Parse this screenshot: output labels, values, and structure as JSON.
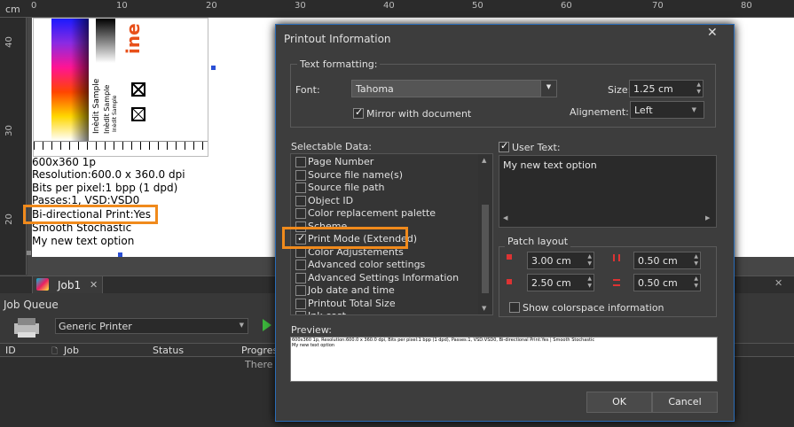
{
  "ruler": {
    "unit": "cm",
    "top_labels": [
      "0",
      "10",
      "20",
      "30",
      "40",
      "50",
      "60",
      "70",
      "80"
    ],
    "left_labels": [
      "40",
      "30",
      "20"
    ]
  },
  "document": {
    "print_strip": {
      "brand": "ine",
      "sample_labels": [
        "Inèdit Sample",
        "Inèdit Sample",
        "Inèdit Sample"
      ]
    },
    "info_lines": [
      "600x360 1p",
      "Resolution:600.0 x 360.0 dpi",
      "Bits per pixel:1 bpp (1 dpd)",
      "Passes:1, VSD:VSD0",
      "Bi-directional Print:Yes",
      "Smooth Stochastic",
      "My new text option"
    ]
  },
  "tabs": {
    "job_tab_label": "Job1",
    "close_glyph": "✕"
  },
  "job_queue": {
    "title": "Job Queue",
    "printer": "Generic Printer",
    "columns": [
      "ID",
      "Job",
      "Status",
      "Progres"
    ],
    "empty_text": "There a"
  },
  "dialog": {
    "title": "Printout Information",
    "text_formatting": {
      "group_label": "Text formatting:",
      "font_label": "Font:",
      "font_value": "Tahoma",
      "size_label": "Size:",
      "size_value": "1.25 cm",
      "mirror_label": "Mirror with document",
      "mirror_checked": true,
      "alignment_label": "Alignement:",
      "alignment_value": "Left"
    },
    "selectable_data": {
      "label": "Selectable Data:",
      "items": [
        {
          "label": "Page Number",
          "checked": false
        },
        {
          "label": "Source file name(s)",
          "checked": false
        },
        {
          "label": "Source file path",
          "checked": false
        },
        {
          "label": "Object ID",
          "checked": false
        },
        {
          "label": "Color replacement palette",
          "checked": false
        },
        {
          "label": "Scheme",
          "checked": false
        },
        {
          "label": "Print Mode (Extended)",
          "checked": true
        },
        {
          "label": "Color Adjustements",
          "checked": false
        },
        {
          "label": "Advanced color settings",
          "checked": false
        },
        {
          "label": "Advanced Settings Information",
          "checked": false
        },
        {
          "label": "Job date and time",
          "checked": false
        },
        {
          "label": "Printout Total Size",
          "checked": false
        },
        {
          "label": "Ink cost",
          "checked": false
        }
      ]
    },
    "user_text": {
      "label": "User Text:",
      "checked": true,
      "value": "My new text option"
    },
    "patch_layout": {
      "label": "Patch layout",
      "values": [
        "3.00 cm",
        "0.50 cm",
        "2.50 cm",
        "0.50 cm"
      ],
      "show_colorspace_label": "Show colorspace information",
      "show_colorspace_checked": false
    },
    "preview": {
      "label": "Preview:",
      "line1": "600x360 1p, Resolution:600.0 x 360.0 dpi, Bits per pixel:1 bpp (1 dpd), Passes:1, VSD:VSD0, Bi-directional Print:Yes | Smooth Stochastic",
      "line2": "My new text option"
    },
    "ok_label": "OK",
    "cancel_label": "Cancel"
  },
  "colors": {
    "highlight": "#f08a1c",
    "accent_blue": "#2a6cb8",
    "green_play": "#3cb43c"
  }
}
